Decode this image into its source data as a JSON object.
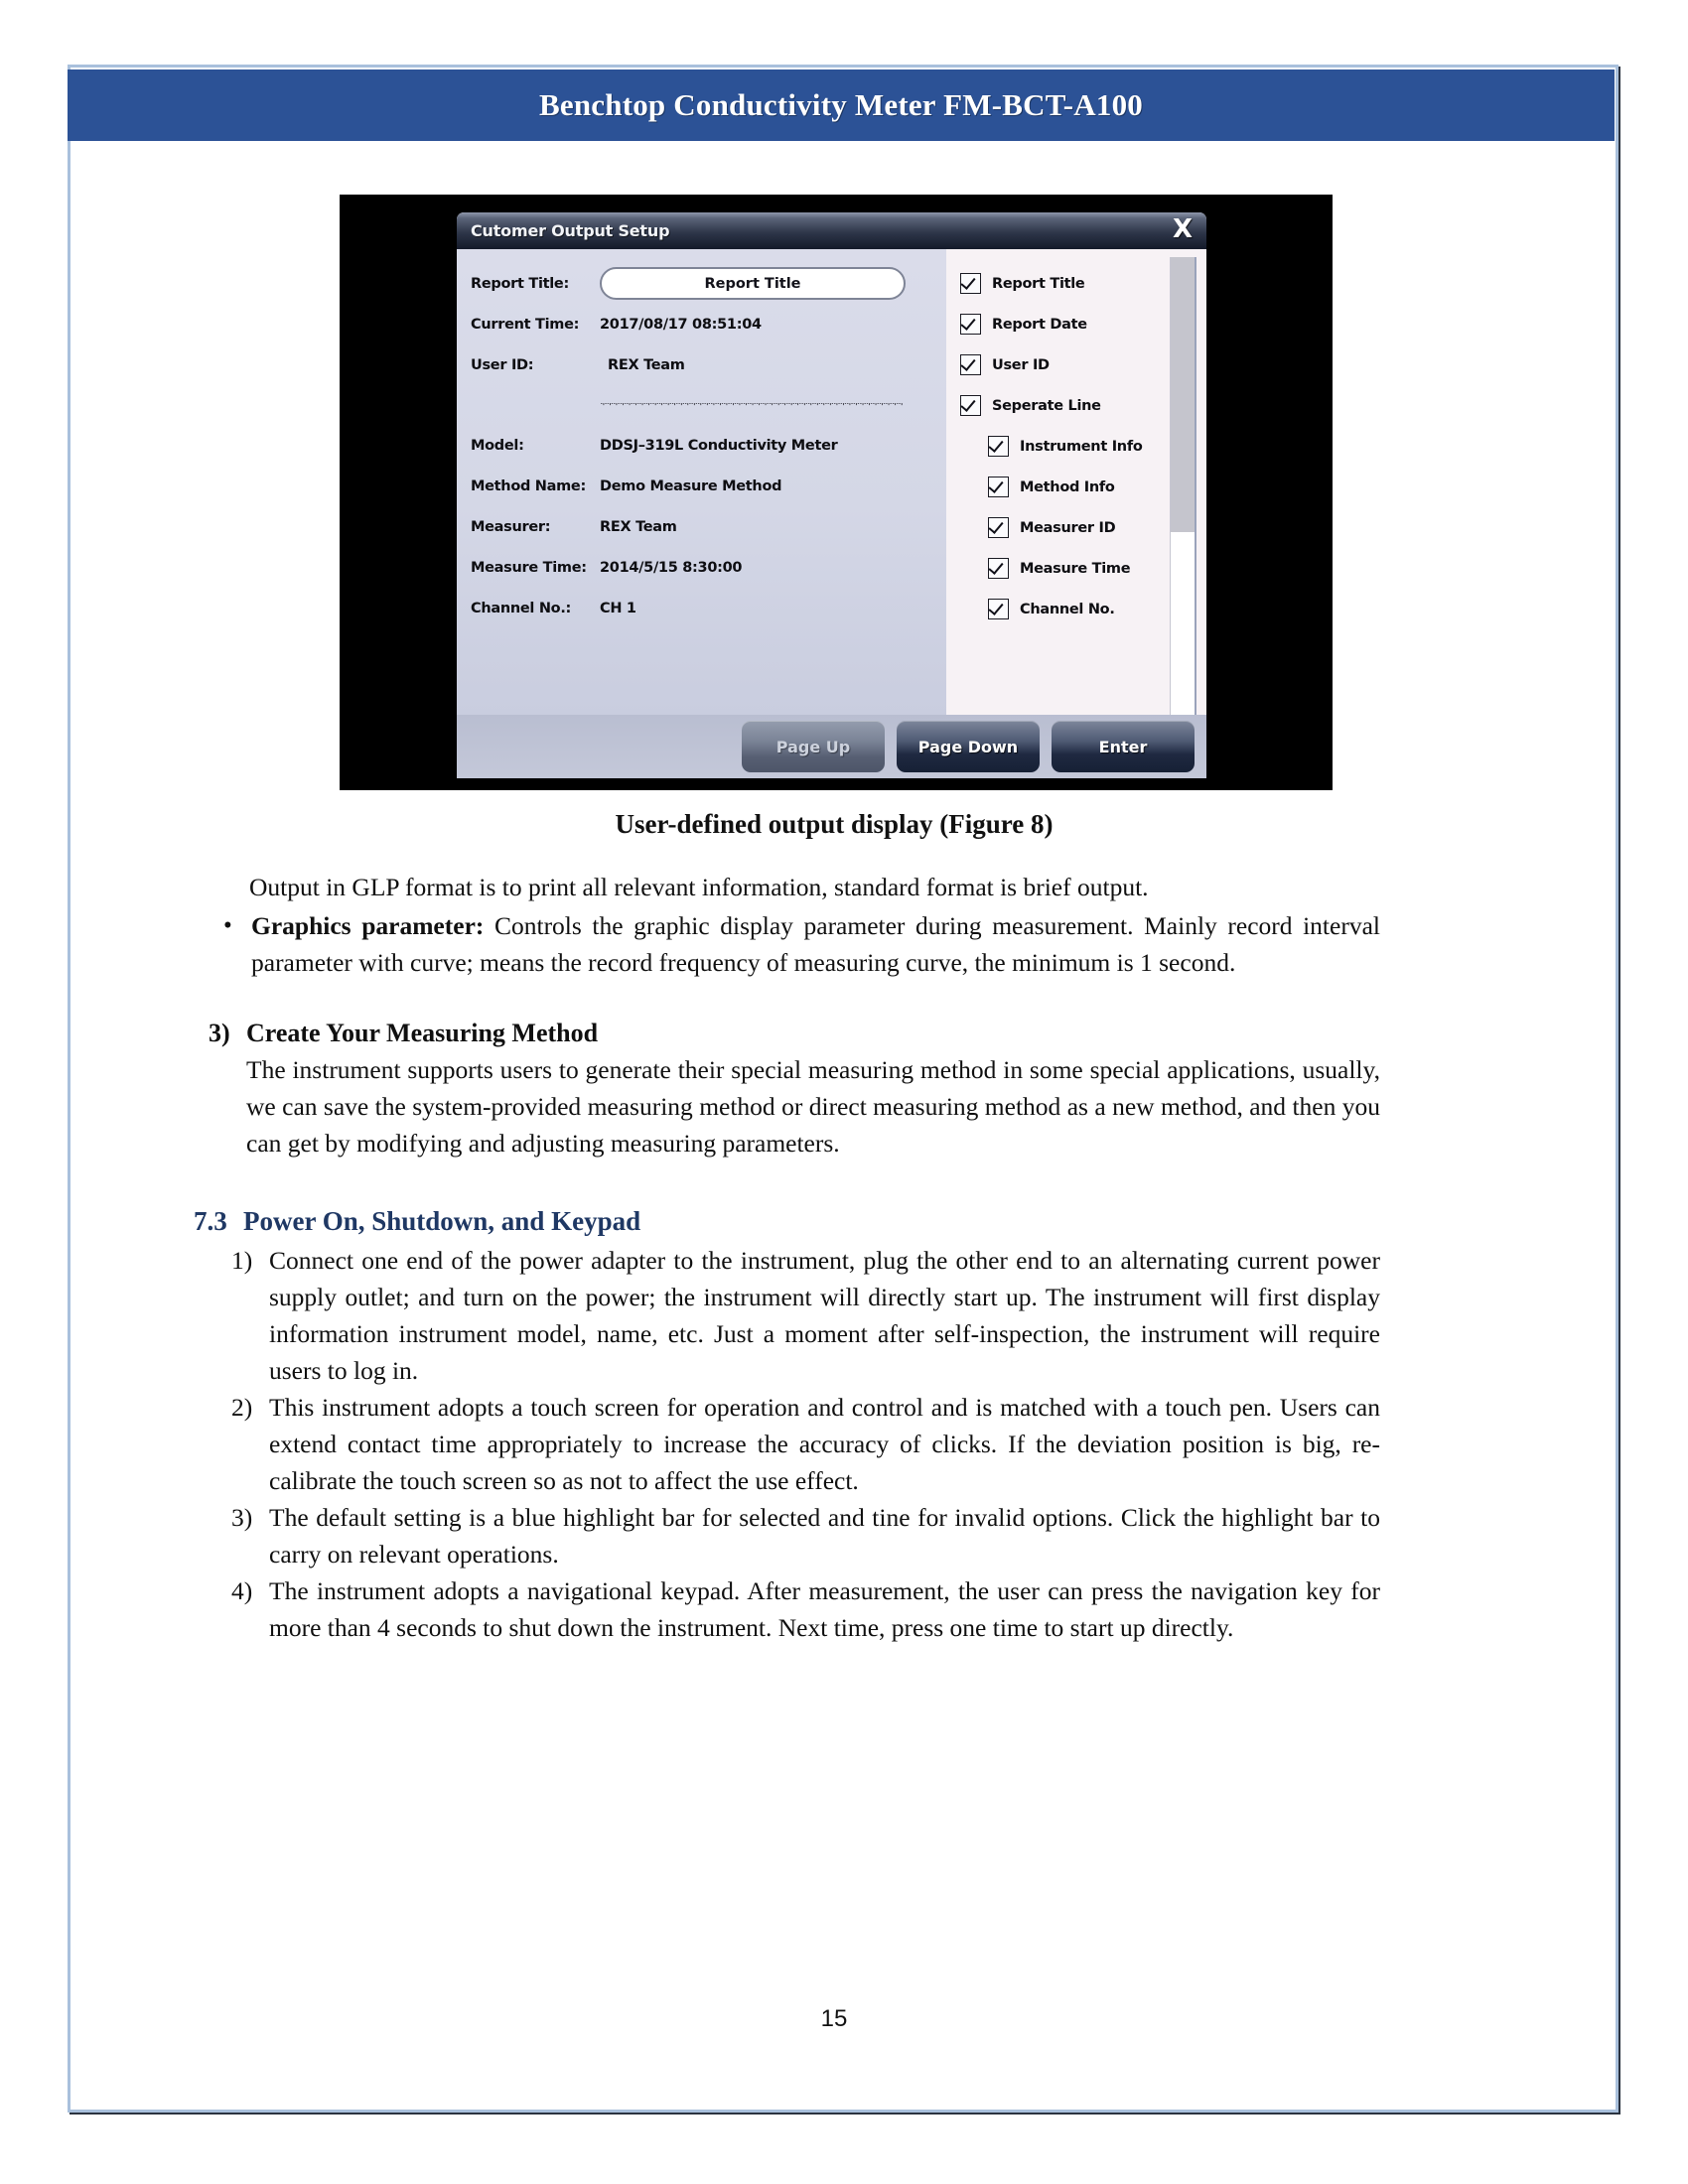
{
  "header": {
    "title": "Benchtop Conductivity Meter FM-BCT-A100"
  },
  "figure": {
    "dialog": {
      "title": "Cutomer Output Setup",
      "close_icon": "X",
      "fields": [
        {
          "label": "Report Title:",
          "value": "Report Title",
          "type": "input"
        },
        {
          "label": "Current Time:",
          "value": "2017/08/17 08:51:04",
          "type": "text"
        },
        {
          "label": "User ID:",
          "value": "REX Team",
          "type": "text"
        },
        {
          "label": "",
          "value": "**********************************************************************",
          "type": "separator"
        },
        {
          "label": "Model:",
          "value": "DDSJ–319L Conductivity Meter",
          "type": "text"
        },
        {
          "label": "Method Name:",
          "value": "Demo Measure Method",
          "type": "text"
        },
        {
          "label": "Measurer:",
          "value": "REX Team",
          "type": "text"
        },
        {
          "label": "Measure Time:",
          "value": "2014/5/15 8:30:00",
          "type": "text"
        },
        {
          "label": "Channel No.:",
          "value": "CH 1",
          "type": "text"
        }
      ],
      "checkboxes": [
        {
          "label": "Report Title",
          "checked": true,
          "indent": false
        },
        {
          "label": "Report Date",
          "checked": true,
          "indent": false
        },
        {
          "label": "User ID",
          "checked": true,
          "indent": false
        },
        {
          "label": "Seperate Line",
          "checked": true,
          "indent": false
        },
        {
          "label": "Instrument Info",
          "checked": true,
          "indent": true
        },
        {
          "label": "Method Info",
          "checked": true,
          "indent": true
        },
        {
          "label": "Measurer ID",
          "checked": true,
          "indent": true
        },
        {
          "label": "Measure Time",
          "checked": true,
          "indent": true
        },
        {
          "label": "Channel No.",
          "checked": true,
          "indent": true
        }
      ],
      "buttons": [
        {
          "label": "Page Up",
          "disabled": true
        },
        {
          "label": "Page Down",
          "disabled": false
        },
        {
          "label": "Enter",
          "disabled": false
        }
      ]
    },
    "caption": "User-defined output display (Figure 8)"
  },
  "body": {
    "intro_paragraph": "Output in GLP format is to print all relevant information, standard format is brief output.",
    "bullet": {
      "dot": "•",
      "term": "Graphics parameter:",
      "text": " Controls the graphic display parameter during measurement. Mainly record interval parameter with curve; means the record frequency of measuring curve, the minimum is 1 second."
    },
    "section3": {
      "marker": "3)",
      "heading": "Create Your Measuring Method",
      "paragraph": "The instrument supports users to generate their special measuring method in some special applications, usually, we can save the system-provided measuring method or direct measuring method as a new method, and then you can get by modifying and adjusting measuring parameters."
    },
    "section73": {
      "number": "7.3",
      "heading": "Power On, Shutdown, and Keypad",
      "items": [
        {
          "marker": "1)",
          "text": "Connect one end of the power adapter to the instrument, plug the other end to an alternating current power supply outlet; and turn on the power; the instrument will directly start up. The instrument will first display information instrument model, name, etc. Just a moment after self-inspection, the instrument will require users to log in."
        },
        {
          "marker": "2)",
          "text": "This instrument adopts a touch screen for operation and control and is matched with a touch pen. Users can extend contact time appropriately to increase the accuracy of clicks. If the deviation position is big, re-calibrate the touch screen so as not to affect the use effect."
        },
        {
          "marker": "3)",
          "text": "The default setting is a blue highlight bar for selected and tine for invalid options. Click the highlight bar to carry on relevant operations."
        },
        {
          "marker": "4)",
          "text": "The instrument adopts a navigational keypad. After measurement, the user can press the navigation key for more than 4 seconds to shut down the instrument. Next time, press one time to start up directly."
        }
      ]
    }
  },
  "footer": {
    "page_number": "15"
  },
  "colors": {
    "header_blue": "#2c5296",
    "heading_navy": "#1f3864",
    "frame_blue": "#a9c0dc"
  }
}
